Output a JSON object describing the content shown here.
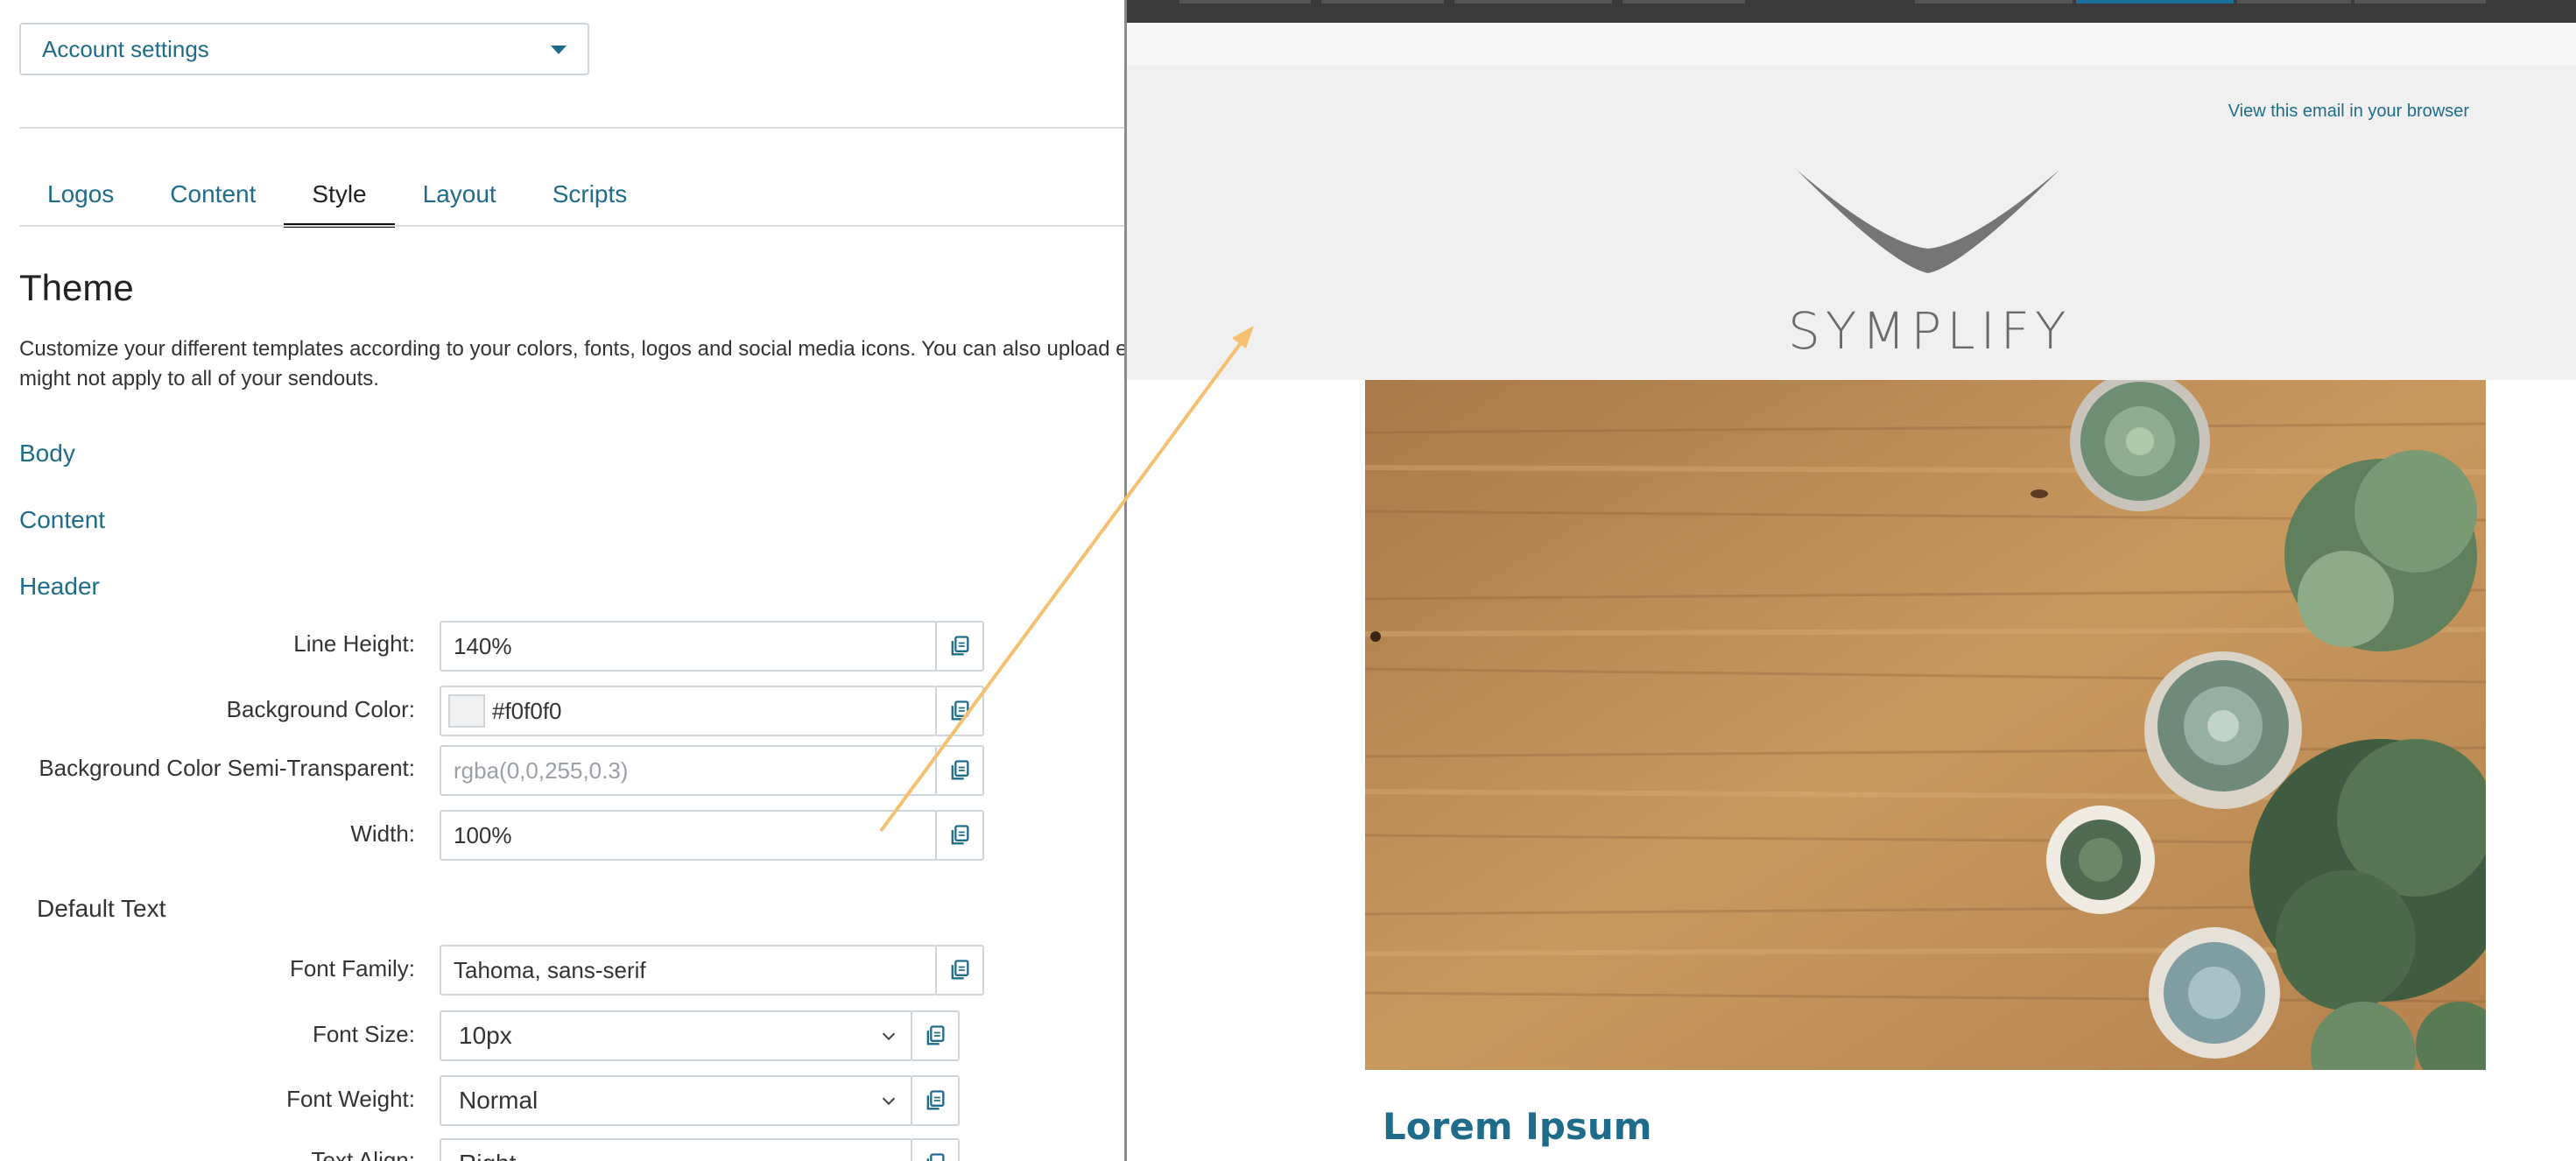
{
  "account_select": {
    "value": "Account settings"
  },
  "tabs": [
    {
      "label": "Logos"
    },
    {
      "label": "Content"
    },
    {
      "label": "Style"
    },
    {
      "label": "Layout"
    },
    {
      "label": "Scripts"
    }
  ],
  "active_tab": "Style",
  "theme": {
    "title": "Theme",
    "description": "Customize your different templates according to your colors, fonts, logos and social media icons. You can also upload e might not apply to all of your sendouts."
  },
  "sections": {
    "body": "Body",
    "content": "Content",
    "header": "Header"
  },
  "header_fields": {
    "line_height": {
      "label": "Line Height:",
      "value": "140%"
    },
    "background_color": {
      "label": "Background Color:",
      "value": "#f0f0f0",
      "swatch": "#f0f0f0"
    },
    "background_semi": {
      "label": "Background Color Semi-Transparent:",
      "placeholder": "rgba(0,0,255,0.3)"
    },
    "width": {
      "label": "Width:",
      "value": "100%"
    }
  },
  "default_text": {
    "heading": "Default Text",
    "font_family": {
      "label": "Font Family:",
      "value": "Tahoma, sans-serif"
    },
    "font_size": {
      "label": "Font Size:",
      "value": "10px"
    },
    "font_weight": {
      "label": "Font Weight:",
      "value": "Normal"
    },
    "text_align": {
      "label": "Text Align:",
      "value": "Right"
    }
  },
  "preview": {
    "view_in_browser": "View this email in your browser",
    "logo_text": "SYMPLIFY",
    "email_title": "Lorem Ipsum"
  },
  "colors": {
    "link": "#1f6c8a",
    "header_bg": "#f0f0f0",
    "arrow": "#f5c06f"
  },
  "icons": {
    "copy": "copy-icon",
    "dropdown": "chevron-down-icon",
    "caret": "caret-down-icon"
  }
}
